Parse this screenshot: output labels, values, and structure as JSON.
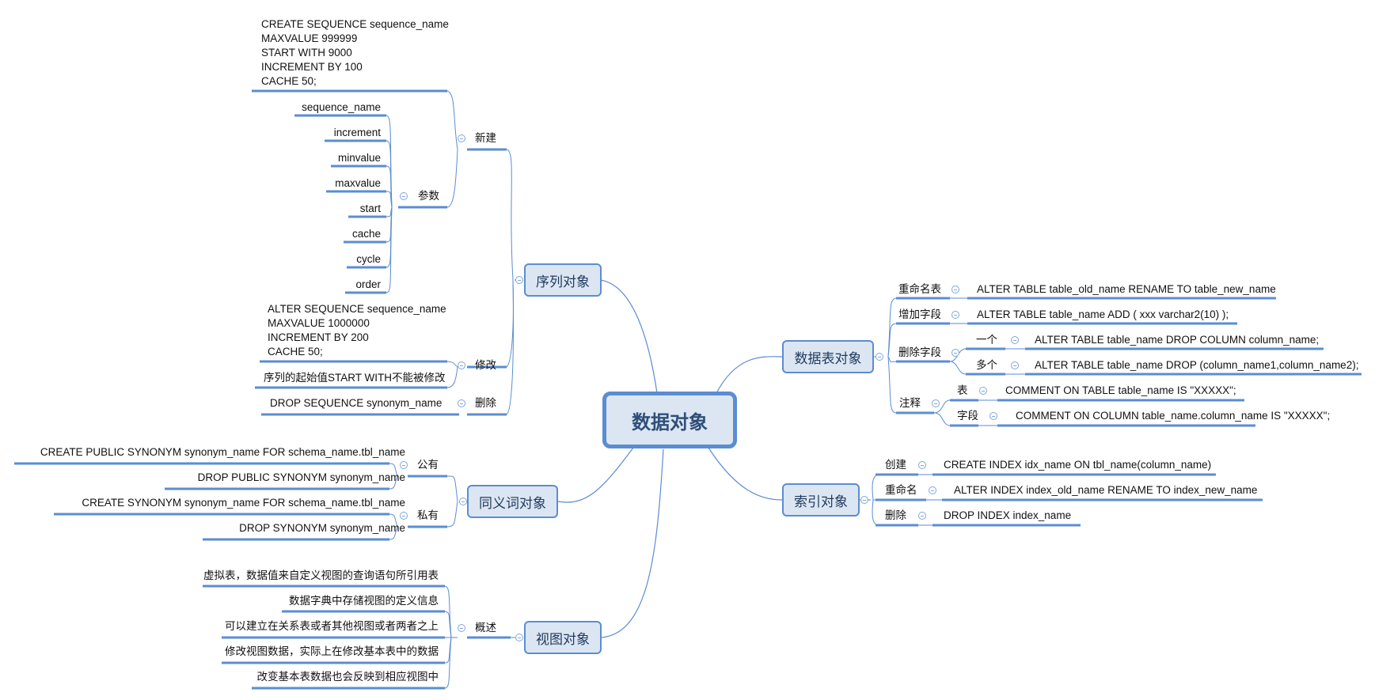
{
  "central": "数据对象",
  "colors": {
    "line": "#5b8dd1",
    "topic_fill": "#dce6f2",
    "topic_border": "#5b8dd1",
    "text": "#111111"
  },
  "sequence": {
    "title": "序列对象",
    "create": {
      "label": "新建",
      "sql": "CREATE SEQUENCE sequence_name\nMAXVALUE 999999\nSTART WITH 9000\nINCREMENT BY 100\nCACHE 50;",
      "params_label": "参数",
      "params": [
        "sequence_name",
        "increment",
        "minvalue",
        "maxvalue",
        "start",
        "cache",
        "cycle",
        "order"
      ]
    },
    "alter": {
      "label": "修改",
      "sql": "ALTER SEQUENCE sequence_name\nMAXVALUE 1000000\nINCREMENT BY 200\nCACHE 50;",
      "note": "序列的起始值START WITH不能被修改"
    },
    "drop": {
      "label": "删除",
      "sql": "DROP SEQUENCE synonym_name"
    }
  },
  "synonym": {
    "title": "同义词对象",
    "public": {
      "label": "公有",
      "items": [
        "CREATE PUBLIC SYNONYM synonym_name FOR schema_name.tbl_name",
        "DROP PUBLIC SYNONYM synonym_name"
      ]
    },
    "private": {
      "label": "私有",
      "items": [
        "CREATE SYNONYM synonym_name FOR schema_name.tbl_name",
        "DROP SYNONYM synonym_name"
      ]
    }
  },
  "view": {
    "title": "视图对象",
    "overview_label": "概述",
    "items": [
      "虚拟表，数据值来自定义视图的查询语句所引用表",
      "数据字典中存储视图的定义信息",
      "可以建立在关系表或者其他视图或者两者之上",
      "修改视图数据，实际上在修改基本表中的数据",
      "改变基本表数据也会反映到相应视图中"
    ]
  },
  "table": {
    "title": "数据表对象",
    "rename": {
      "label": "重命名表",
      "sql": "ALTER TABLE table_old_name RENAME TO table_new_name"
    },
    "add": {
      "label": "增加字段",
      "sql": "ALTER TABLE table_name ADD ( xxx varchar2(10)  );"
    },
    "drop": {
      "label": "删除字段",
      "one": {
        "label": "一个",
        "sql": "ALTER TABLE table_name DROP COLUMN column_name;"
      },
      "many": {
        "label": "多个",
        "sql": "ALTER TABLE table_name DROP (column_name1,column_name2);"
      }
    },
    "comment": {
      "label": "注释",
      "table": {
        "label": "表",
        "sql": "COMMENT ON TABLE table_name IS \"XXXXX\";"
      },
      "column": {
        "label": "字段",
        "sql": "COMMENT ON COLUMN table_name.column_name IS \"XXXXX\";"
      }
    }
  },
  "index": {
    "title": "索引对象",
    "create": {
      "label": "创建",
      "sql": "CREATE INDEX idx_name ON tbl_name(column_name)"
    },
    "rename": {
      "label": "重命名",
      "sql": "ALTER INDEX index_old_name RENAME TO index_new_name"
    },
    "drop": {
      "label": "删除",
      "sql": "DROP INDEX index_name"
    }
  }
}
